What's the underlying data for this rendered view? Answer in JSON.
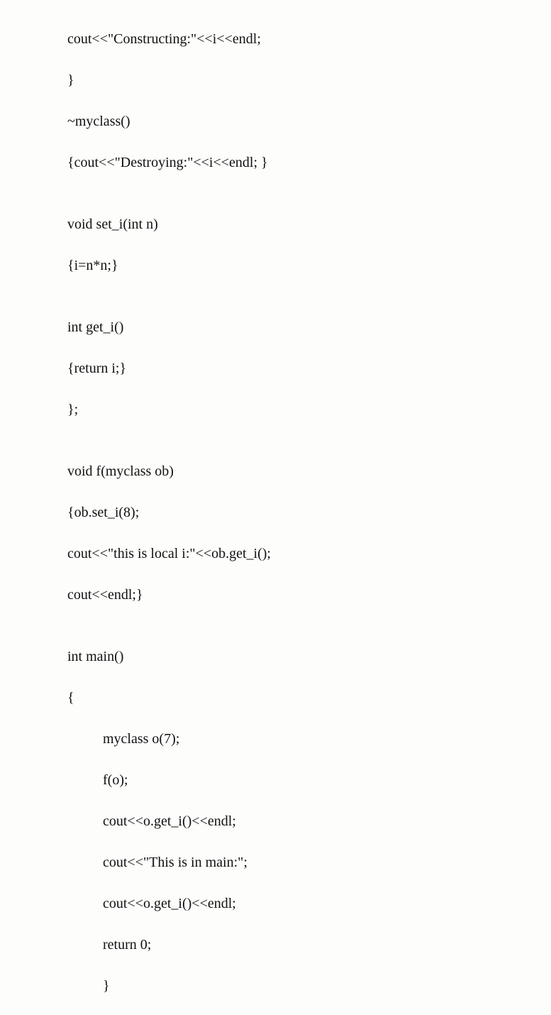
{
  "code": {
    "l01": "cout<<\"Constructing:\"<<i<<endl;",
    "l02": "}",
    "l03": "~myclass()",
    "l04": "{cout<<\"Destroying:\"<<i<<endl; }",
    "l05": "",
    "l06": "void set_i(int n)",
    "l07": "{i=n*n;}",
    "l08": "",
    "l09": "int get_i()",
    "l10": "{return i;}",
    "l11": "};",
    "l12": "",
    "l13": "void f(myclass ob)",
    "l14": "{ob.set_i(8);",
    "l15": "cout<<\"this is local i:\"<<ob.get_i();",
    "l16": "cout<<endl;}",
    "l17": "",
    "l18": "int main()",
    "l19": "{",
    "l20": "myclass o(7);",
    "l21": "f(o);",
    "l22": "cout<<o.get_i()<<endl;",
    "l23": "cout<<\"This is in main:\";",
    "l24": "cout<<o.get_i()<<endl;",
    "l25": "return 0;",
    "l26": "}"
  }
}
